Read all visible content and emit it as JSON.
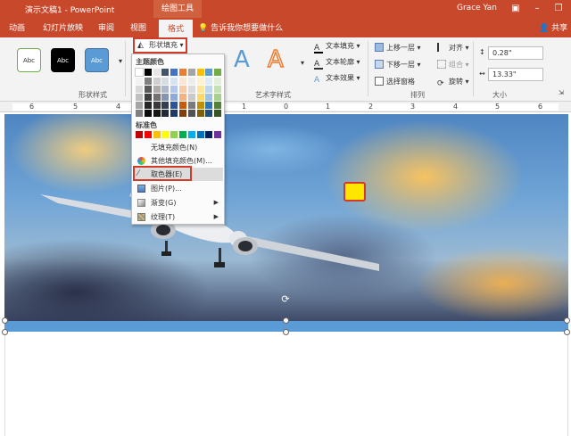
{
  "titlebar": {
    "doc_title": "演示文稿1 - PowerPoint",
    "tool_context": "绘图工具",
    "user_name": "Grace Yan"
  },
  "tabs": [
    {
      "label": "动画"
    },
    {
      "label": "幻灯片放映"
    },
    {
      "label": "审阅"
    },
    {
      "label": "视图"
    },
    {
      "label": "格式"
    }
  ],
  "tell_me": "告诉我你想要做什么",
  "share_label": "共享",
  "ribbon": {
    "shape_styles": {
      "group_label": "形状样式",
      "swatches": [
        {
          "label": "Abc",
          "bg": "#ffffff",
          "fg": "#333333",
          "border": "#70ad47"
        },
        {
          "label": "Abc",
          "bg": "#000000",
          "fg": "#ffffff",
          "border": "#000000"
        },
        {
          "label": "Abc",
          "bg": "#5b9bd5",
          "fg": "#ffffff",
          "border": "#41719c"
        }
      ],
      "shape_fill_label": "形状填充"
    },
    "wordart": {
      "group_label": "艺术字样式",
      "text_fill": "文本填充",
      "text_outline": "文本轮廓",
      "text_effects": "文本效果"
    },
    "arrange": {
      "group_label": "排列",
      "bring_forward": "上移一层",
      "send_backward": "下移一层",
      "selection_pane": "选择窗格",
      "align": "对齐",
      "group": "组合",
      "rotate": "旋转"
    },
    "size": {
      "group_label": "大小",
      "height": "0.28\"",
      "width": "13.33\""
    }
  },
  "ruler": {
    "labels": [
      "6",
      "5",
      "4",
      "1",
      "0",
      "1",
      "2",
      "3",
      "4",
      "5",
      "6"
    ]
  },
  "dropdown": {
    "theme_colors_label": "主题颜色",
    "standard_colors_label": "标准色",
    "theme_colors": [
      [
        "#ffffff",
        "#000000",
        "#e7e6e6",
        "#44546a",
        "#4472c4",
        "#ed7d31",
        "#a5a5a5",
        "#ffc000",
        "#5b9bd5",
        "#70ad47"
      ],
      [
        "#f2f2f2",
        "#7f7f7f",
        "#d0cece",
        "#d6dce4",
        "#d9e2f3",
        "#fbe5d5",
        "#ededed",
        "#fff2cc",
        "#deebf6",
        "#e2efd9"
      ],
      [
        "#d8d8d8",
        "#595959",
        "#aeabab",
        "#adb9ca",
        "#b4c6e7",
        "#f7caac",
        "#dbdbdb",
        "#fee599",
        "#bdd7ee",
        "#c5e0b3"
      ],
      [
        "#bfbfbf",
        "#3f3f3f",
        "#757070",
        "#8496b0",
        "#8eaadb",
        "#f4b183",
        "#c9c9c9",
        "#ffd965",
        "#9cc3e5",
        "#a8d08d"
      ],
      [
        "#a5a5a5",
        "#262626",
        "#3a3838",
        "#323f4f",
        "#2f5496",
        "#c55a11",
        "#7b7b7b",
        "#bf9000",
        "#2e75b5",
        "#538135"
      ],
      [
        "#7f7f7f",
        "#0c0c0c",
        "#171616",
        "#222a35",
        "#1f3864",
        "#833c0b",
        "#525252",
        "#7f6000",
        "#1e4e79",
        "#375623"
      ]
    ],
    "standard_colors": [
      "#c00000",
      "#ff0000",
      "#ffc000",
      "#ffff00",
      "#92d050",
      "#00b050",
      "#00b0f0",
      "#0070c0",
      "#002060",
      "#7030a0"
    ],
    "items": [
      {
        "label": "无填充颜色(N)",
        "icon": "no-fill-icon"
      },
      {
        "label": "其他填充颜色(M)...",
        "icon": "palette-icon"
      },
      {
        "label": "取色器(E)",
        "icon": "eyedropper-icon"
      },
      {
        "label": "图片(P)...",
        "icon": "picture-icon"
      },
      {
        "label": "渐变(G)",
        "icon": "gradient-icon"
      },
      {
        "label": "纹理(T)",
        "icon": "texture-icon"
      }
    ]
  }
}
